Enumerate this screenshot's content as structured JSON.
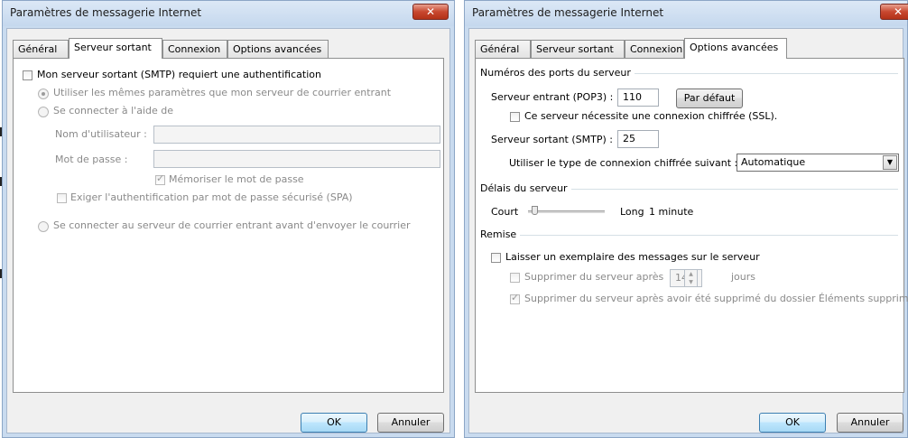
{
  "left_dialog": {
    "title": "Paramètres de messagerie Internet",
    "close_label": "✕",
    "tabs": [
      "Général",
      "Serveur sortant",
      "Connexion",
      "Options avancées"
    ],
    "smtp_auth_label": "Mon serveur sortant (SMTP) requiert une authentification",
    "use_same_label": "Utiliser les mêmes paramètres que mon serveur de courrier entrant",
    "connect_with_label": "Se connecter à l'aide de",
    "username_label": "Nom d'utilisateur :",
    "username_value": "",
    "password_label": "Mot de passe :",
    "password_value": "",
    "remember_password_label": "Mémoriser le mot de passe",
    "spa_label": "Exiger l'authentification par mot de passe sécurisé (SPA)",
    "connect_before_send_label": "Se connecter au serveur de courrier entrant avant d'envoyer le courrier",
    "ok_label": "OK",
    "cancel_label": "Annuler"
  },
  "right_dialog": {
    "title": "Paramètres de messagerie Internet",
    "close_label": "✕",
    "tabs": [
      "Général",
      "Serveur sortant",
      "Connexion",
      "Options avancées"
    ],
    "ports_group": "Numéros des ports du serveur",
    "incoming_label": "Serveur entrant (POP3) :",
    "incoming_value": "110",
    "default_button": "Par défaut",
    "ssl_label": "Ce serveur nécessite une connexion chiffrée (SSL).",
    "outgoing_label": "Serveur sortant (SMTP) :",
    "outgoing_value": "25",
    "encryption_label": "Utiliser le type de connexion chiffrée suivant :",
    "encryption_value": "Automatique",
    "timeout_group": "Délais du serveur",
    "short_label": "Court",
    "long_label": "Long",
    "timeout_value": "1 minute",
    "timeout_level": 0.05,
    "delivery_group": "Remise",
    "leave_copy_label": "Laisser un exemplaire des messages sur le serveur",
    "remove_after_label": "Supprimer du serveur après",
    "remove_after_days": "14",
    "days_label": "jours",
    "remove_deleted_label": "Supprimer du serveur après avoir été supprimé du dossier Éléments supprimés",
    "ok_label": "OK",
    "cancel_label": "Annuler"
  }
}
